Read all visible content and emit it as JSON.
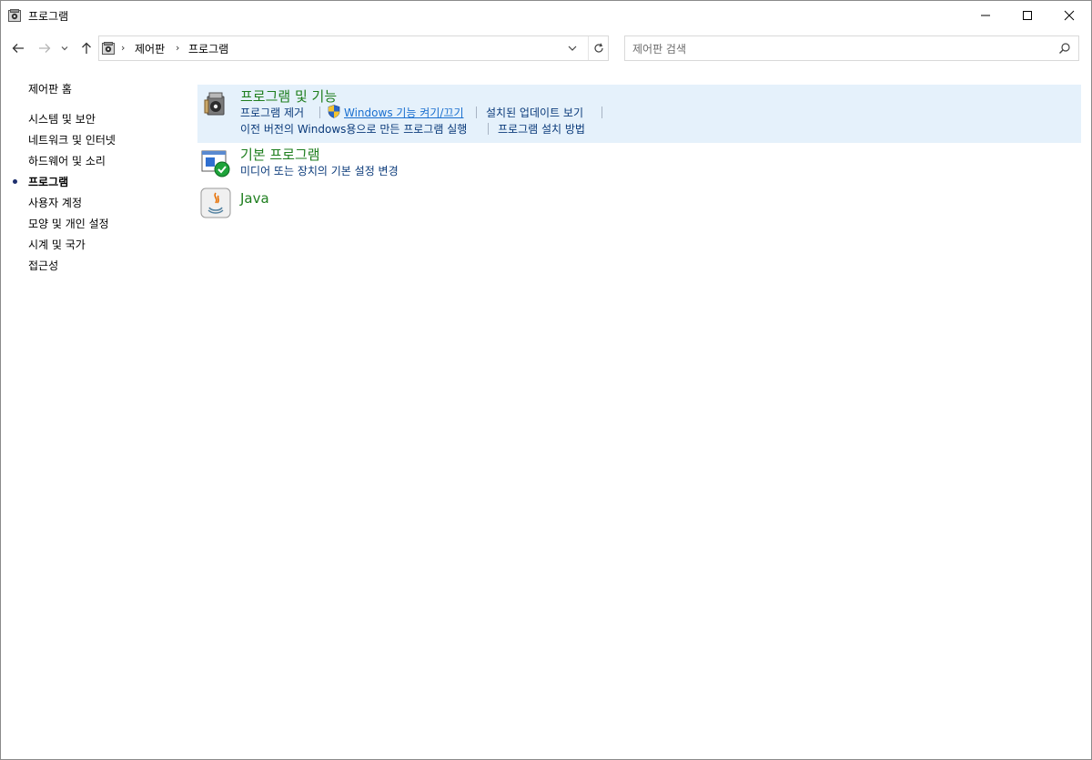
{
  "window": {
    "title": "프로그램"
  },
  "address": {
    "crumbs": [
      "제어판",
      "프로그램"
    ]
  },
  "search": {
    "placeholder": "제어판 검색"
  },
  "leftnav": {
    "items": [
      {
        "label": "제어판 홈",
        "current": false
      },
      {
        "label": "시스템 및 보안",
        "current": false
      },
      {
        "label": "네트워크 및 인터넷",
        "current": false
      },
      {
        "label": "하드웨어 및 소리",
        "current": false
      },
      {
        "label": "프로그램",
        "current": true
      },
      {
        "label": "사용자 계정",
        "current": false
      },
      {
        "label": "모양 및 개인 설정",
        "current": false
      },
      {
        "label": "시계 및 국가",
        "current": false
      },
      {
        "label": "접근성",
        "current": false
      }
    ]
  },
  "categories": [
    {
      "title": "프로그램 및 기능",
      "icon": "programs-features-icon",
      "links": [
        "프로그램 제거",
        "Windows 기능 켜기/끄기",
        "설치된 업데이트 보기",
        "이전 버전의 Windows용으로 만든 프로그램 실행",
        "프로그램 설치 방법"
      ]
    },
    {
      "title": "기본 프로그램",
      "icon": "default-programs-icon",
      "links": [
        "미디어 또는 장치의 기본 설정 변경"
      ]
    },
    {
      "title": "Java",
      "icon": "java-icon",
      "links": []
    }
  ],
  "colors": {
    "category_title": "#1e7e1e",
    "link": "#0a3a7a",
    "highlight": "#e5f1fb"
  }
}
